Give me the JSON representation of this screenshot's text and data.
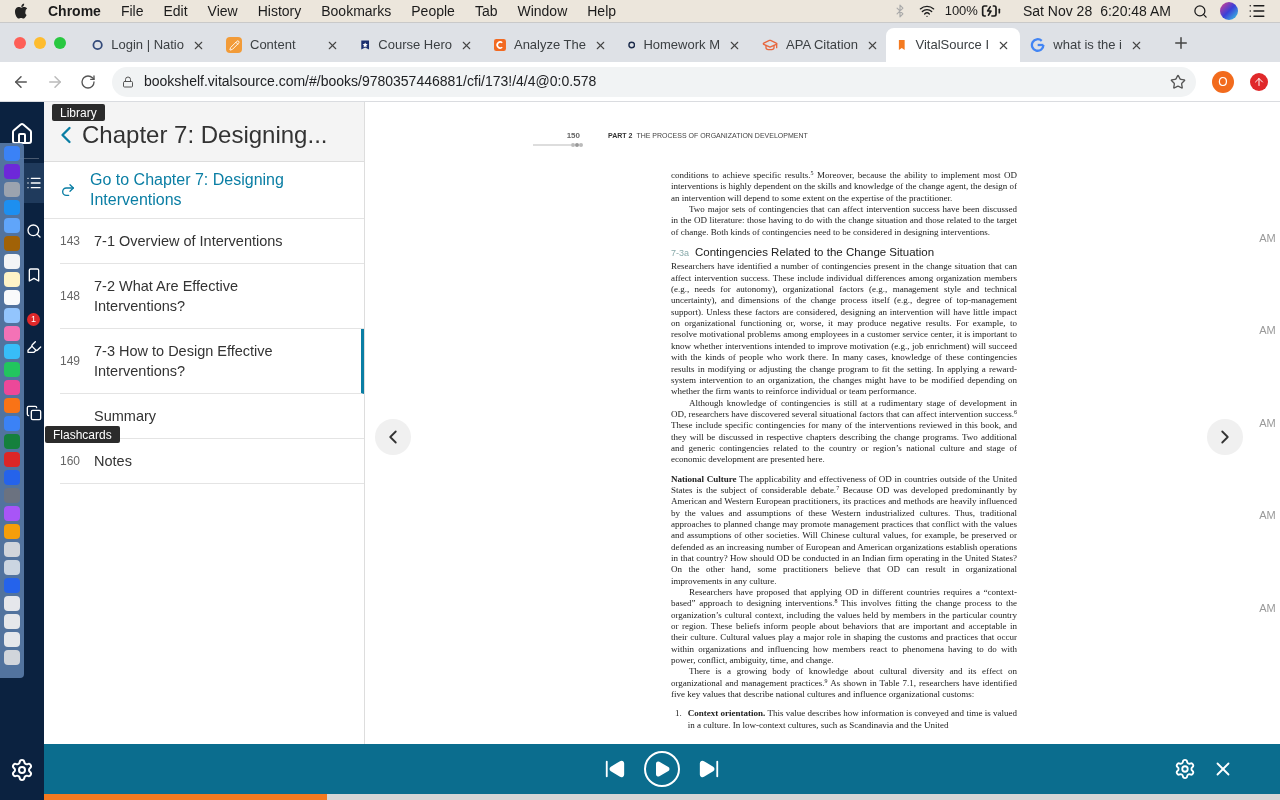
{
  "menu_bar": {
    "app": "Chrome",
    "items": [
      "File",
      "Edit",
      "View",
      "History",
      "Bookmarks",
      "People",
      "Tab",
      "Window",
      "Help"
    ],
    "battery": "100%",
    "date": "Sat Nov 28",
    "time": "6:20:48 AM"
  },
  "tabs": [
    {
      "title": "Login | Natio",
      "selected": false
    },
    {
      "title": "Content",
      "selected": false
    },
    {
      "title": "Course Hero",
      "selected": false
    },
    {
      "title": "Analyze The",
      "selected": false
    },
    {
      "title": "Homework M",
      "selected": false
    },
    {
      "title": "APA Citation",
      "selected": false
    },
    {
      "title": "VitalSource I",
      "selected": true
    },
    {
      "title": "what is the i",
      "selected": false
    }
  ],
  "address_bar": {
    "url": "bookshelf.vitalsource.com/#/books/9780357446881/cfi/173!/4/4@0:0.578",
    "profile": "O"
  },
  "tooltips": {
    "library": "Library",
    "flashcards": "Flashcards"
  },
  "dock": {
    "badge": "1"
  },
  "toc": {
    "title": "Chapter 7: Designing...",
    "goto": "Go to Chapter 7: Designing Interventions",
    "items": [
      {
        "page": "143",
        "title": "7-1 Overview of Interventions",
        "selected": false
      },
      {
        "page": "148",
        "title": "7-2 What Are Effective Interventions?",
        "selected": false
      },
      {
        "page": "149",
        "title": "7-3 How to Design Effective Interventions?",
        "selected": true
      },
      {
        "title": "Summary",
        "selected": false
      },
      {
        "page": "160",
        "title": "Notes",
        "selected": false
      }
    ]
  },
  "page": {
    "number": "150",
    "part": "PART 2",
    "part_title": "THE PROCESS OF ORGANIZATION DEVELOPMENT",
    "heading": {
      "number": "7-3a",
      "title": "Contingencies Related to the Change Situation"
    },
    "before": [
      {
        "kind": "para",
        "text": "conditions to achieve specific results.$^{5}$ Moreover, because the ability to implement most OD interventions is highly dependent on the skills and knowledge of the change agent, the design of an intervention will depend to some extent on the expertise of the practitioner."
      },
      {
        "kind": "indent",
        "text": "Two major sets of contingencies that can affect intervention success have been discussed in the OD literature: those having to do with the change situation and those related to the target of change. Both kinds of contingencies need to be considered in designing interventions."
      }
    ],
    "after": [
      {
        "kind": "para",
        "text": "Researchers have identified a number of contingencies present in the change situation that can affect intervention success. These include individual differences among organization members (e.g., needs for autonomy), organizational factors (e.g., management style and technical uncertainty), and dimensions of the change process itself (e.g., degree of top-management support). Unless these factors are considered, designing an intervention will have little impact on organizational functioning or, worse, it may produce negative results. For example, to resolve motivational problems among employees in a customer service center, it is important to know whether interventions intended to improve motivation (e.g., job enrichment) will succeed with the kinds of people who work there. In many cases, knowledge of these contingencies results in modifying or adjusting the change program to fit the setting. In applying a reward-system intervention to an organization, the changes might have to be modified depending on whether the firm wants to reinforce individual or team performance."
      },
      {
        "kind": "indent",
        "text": "Although knowledge of contingencies is still at a rudimentary stage of development in OD, researchers have discovered several situational factors that can affect intervention success.$^{6}$ These include specific contingencies for many of the interventions reviewed in this book, and they will be discussed in respective chapters describing the change programs. Two additional and generic contingencies related to the country or region’s national culture and stage of economic development are presented here."
      },
      {
        "kind": "section",
        "text": "**National Culture** The applicability and effectiveness of OD in countries outside of the United States is the subject of considerable debate.$^{7}$ Because OD was developed predominantly by American and Western European practitioners, its practices and methods are heavily influenced by the values and assumptions of these Western industrialized cultures. Thus, traditional approaches to planned change may promote management practices that conflict with the values and assumptions of other societies. Will Chinese cultural values, for example, be preserved or defended as an increasing number of European and American organizations establish operations in that country? How should OD be conducted in an Indian firm operating in the United States? On the other hand, some practitioners believe that OD can result in organizational improvements in any culture."
      },
      {
        "kind": "indent",
        "text": "Researchers have proposed that applying OD in different countries requires a “context-based” approach to designing interventions.$^{8}$ This involves fitting the change process to the organization’s cultural context, including the values held by members in the particular country or region. These beliefs inform people about behaviors that are important and acceptable in their culture. Cultural values play a major role in shaping the customs and practices that occur within organizations and influencing how members react to phenomena having to do with power, conflict, ambiguity, time, and change."
      },
      {
        "kind": "indent",
        "text": "There is a growing body of knowledge about cultural diversity and its effect on organizational and management practices.$^{9}$ As shown in Table 7.1, researchers have identified five key values that describe national cultures and influence organizational customs:"
      },
      {
        "kind": "list",
        "number": "1.",
        "text": "**Context orientation.** This value describes how information is conveyed and time is valued in a culture. In low-context cultures, such as Scandinavia and the United"
      }
    ]
  },
  "background_labels": [
    "AM",
    "AM",
    "AM",
    "AM",
    "AM"
  ],
  "progress": {
    "level": 0.229
  }
}
